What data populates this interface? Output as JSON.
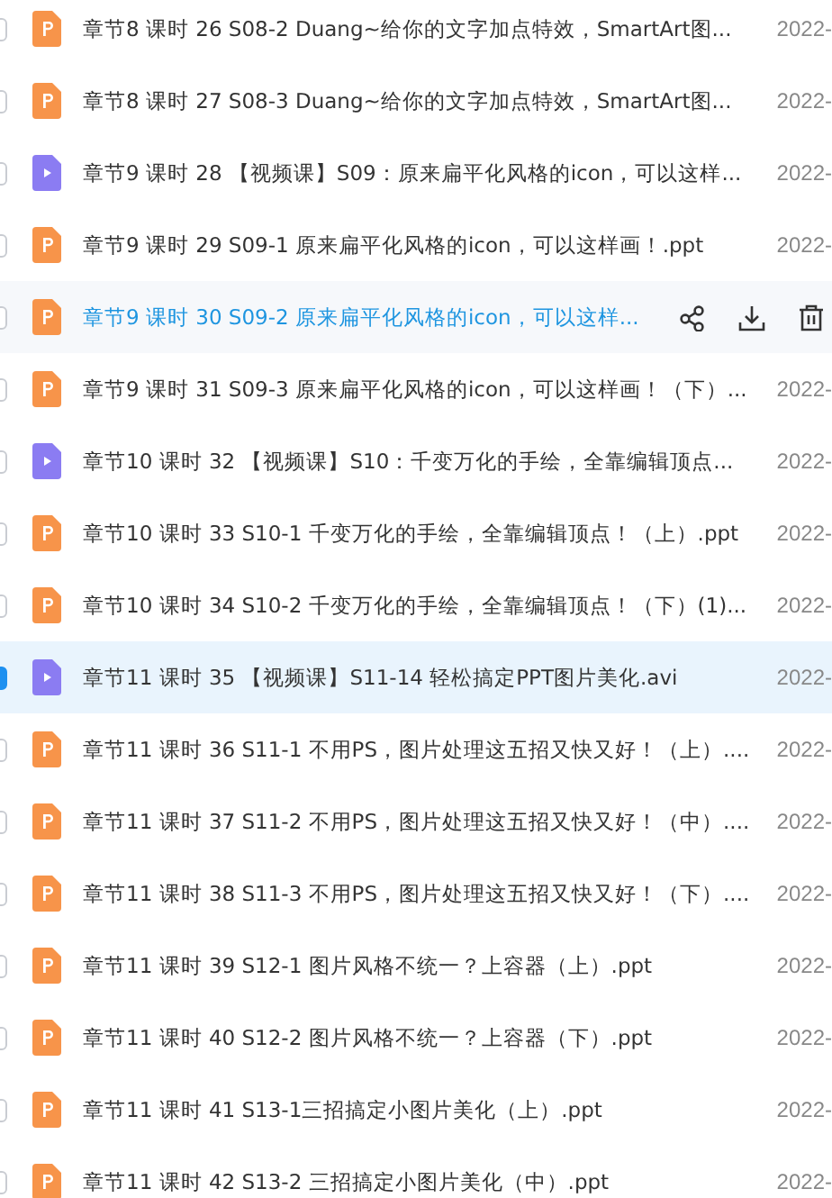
{
  "files": [
    {
      "kind": "ppt",
      "name": "章节8 课时 26 S08-2 Duang~给你的文字加点特效，SmartArt图...",
      "date": "2022-",
      "checked": false,
      "hovered": false
    },
    {
      "kind": "ppt",
      "name": "章节8 课时 27 S08-3 Duang~给你的文字加点特效，SmartArt图...",
      "date": "2022-",
      "checked": false,
      "hovered": false
    },
    {
      "kind": "video",
      "name": "章节9 课时 28 【视频课】S09：原来扁平化风格的icon，可以这样...",
      "date": "2022-",
      "checked": false,
      "hovered": false
    },
    {
      "kind": "ppt",
      "name": "章节9 课时 29 S09-1 原来扁平化风格的icon，可以这样画！.ppt",
      "date": "2022-",
      "checked": false,
      "hovered": false
    },
    {
      "kind": "ppt",
      "name": "章节9 课时 30 S09-2 原来扁平化风格的icon，可以这样...",
      "checked": false,
      "hovered": true
    },
    {
      "kind": "ppt",
      "name": "章节9 课时 31 S09-3 原来扁平化风格的icon，可以这样画！（下）...",
      "date": "2022-",
      "checked": false,
      "hovered": false
    },
    {
      "kind": "video",
      "name": "章节10 课时 32 【视频课】S10：千变万化的手绘，全靠编辑顶点...",
      "date": "2022-",
      "checked": false,
      "hovered": false
    },
    {
      "kind": "ppt",
      "name": "章节10 课时 33 S10-1 千变万化的手绘，全靠编辑顶点！（上）.ppt",
      "date": "2022-",
      "checked": false,
      "hovered": false
    },
    {
      "kind": "ppt",
      "name": "章节10 课时 34 S10-2 千变万化的手绘，全靠编辑顶点！（下）(1)...",
      "date": "2022-",
      "checked": false,
      "hovered": false
    },
    {
      "kind": "video",
      "name": "章节11 课时 35 【视频课】S11-14 轻松搞定PPT图片美化.avi",
      "date": "2022-",
      "checked": true,
      "hovered": false
    },
    {
      "kind": "ppt",
      "name": "章节11 课时 36 S11-1 不用PS，图片处理这五招又快又好！（上）....",
      "date": "2022-",
      "checked": false,
      "hovered": false
    },
    {
      "kind": "ppt",
      "name": "章节11 课时 37 S11-2 不用PS，图片处理这五招又快又好！（中）....",
      "date": "2022-",
      "checked": false,
      "hovered": false
    },
    {
      "kind": "ppt",
      "name": "章节11 课时 38 S11-3 不用PS，图片处理这五招又快又好！（下）....",
      "date": "2022-",
      "checked": false,
      "hovered": false
    },
    {
      "kind": "ppt",
      "name": "章节11 课时 39 S12-1 图片风格不统一？上容器（上）.ppt",
      "date": "2022-",
      "checked": false,
      "hovered": false
    },
    {
      "kind": "ppt",
      "name": "章节11 课时 40 S12-2 图片风格不统一？上容器（下）.ppt",
      "date": "2022-",
      "checked": false,
      "hovered": false
    },
    {
      "kind": "ppt",
      "name": "章节11 课时 41 S13-1三招搞定小图片美化（上）.ppt",
      "date": "2022-",
      "checked": false,
      "hovered": false
    },
    {
      "kind": "ppt",
      "name": "章节11 课时 42 S13-2 三招搞定小图片美化（中）.ppt",
      "date": "2022-",
      "checked": false,
      "hovered": false
    }
  ]
}
